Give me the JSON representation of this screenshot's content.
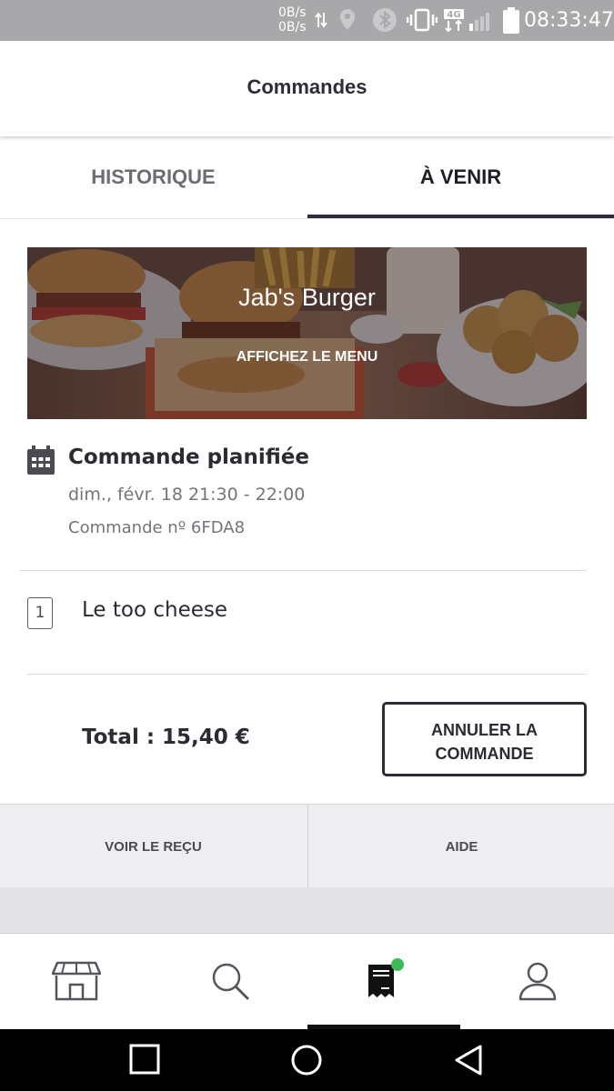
{
  "status_bar": {
    "net_up": "0B/s",
    "net_down": "0B/s",
    "network_type": "4G",
    "time": "08:33:47"
  },
  "header": {
    "title": "Commandes"
  },
  "tabs": [
    {
      "label": "HISTORIQUE",
      "active": false
    },
    {
      "label": "À VENIR",
      "active": true
    }
  ],
  "restaurant": {
    "name": "Jab's Burger",
    "menu_link": "AFFICHEZ LE MENU"
  },
  "order": {
    "status": "Commande planifiée",
    "schedule": "dim., févr. 18 21:30 - 22:00",
    "number": "Commande nº 6FDA8",
    "items": [
      {
        "qty": "1",
        "name": "Le too cheese"
      }
    ],
    "total": "Total : 15,40 €",
    "cancel_label": "ANNULER LA COMMANDE"
  },
  "actions": {
    "receipt": "VOIR LE REÇU",
    "help": "AIDE"
  },
  "bottom_nav": {
    "items": [
      {
        "icon": "store-icon"
      },
      {
        "icon": "search-icon"
      },
      {
        "icon": "receipt-icon",
        "active": true,
        "badge_color": "#3dbb5b"
      },
      {
        "icon": "profile-icon"
      }
    ]
  },
  "colors": {
    "accent": "#2c2c3a",
    "status_bar": "#a8a8aa",
    "badge": "#3dbb5b"
  }
}
